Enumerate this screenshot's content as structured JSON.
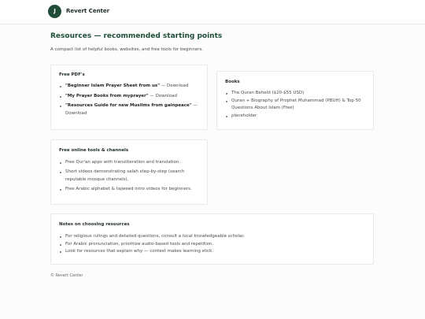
{
  "header": {
    "logo_letter": "J",
    "brand": "Revert Center"
  },
  "main": {
    "title": "Resources — recommended starting points",
    "subtitle": "A compact list of helpful books, websites, and free tools for beginners."
  },
  "pdfs": {
    "heading": "Free PDF's",
    "items": [
      {
        "title": "\"Beginner Islam Prayer Sheet from us\"",
        "action": " — Download"
      },
      {
        "title": "\"My Prayer Books from myprayer\"",
        "action": " — Download"
      },
      {
        "title": "\"Resources Guide for new Muslims from gainpeace\"",
        "action": " — Download"
      }
    ]
  },
  "books": {
    "heading": "Books",
    "items": [
      "The Quran Beheld ($20-$55 USD)",
      "Quran + Biography of Prophet Muhammad (PBUH) & Top 50 Questions About Islam (Free)",
      "placeholder"
    ]
  },
  "tools": {
    "heading": "Free online tools & channels",
    "items": [
      "Free Qur'an apps with transliteration and translation.",
      "Short videos demonstrating salah step-by-step (search reputable mosque channels).",
      "Free Arabic alphabet & tajweed intro videos for beginners."
    ]
  },
  "notes": {
    "heading": "Notes on choosing resources",
    "items": [
      "For religious rulings and detailed questions, consult a local knowledgeable scholar.",
      "For Arabic pronunciation, prioritize audio-based tools and repetition.",
      "Look for resources that explain why — context makes learning stick."
    ]
  },
  "footer": {
    "text": "© Revert Center"
  }
}
